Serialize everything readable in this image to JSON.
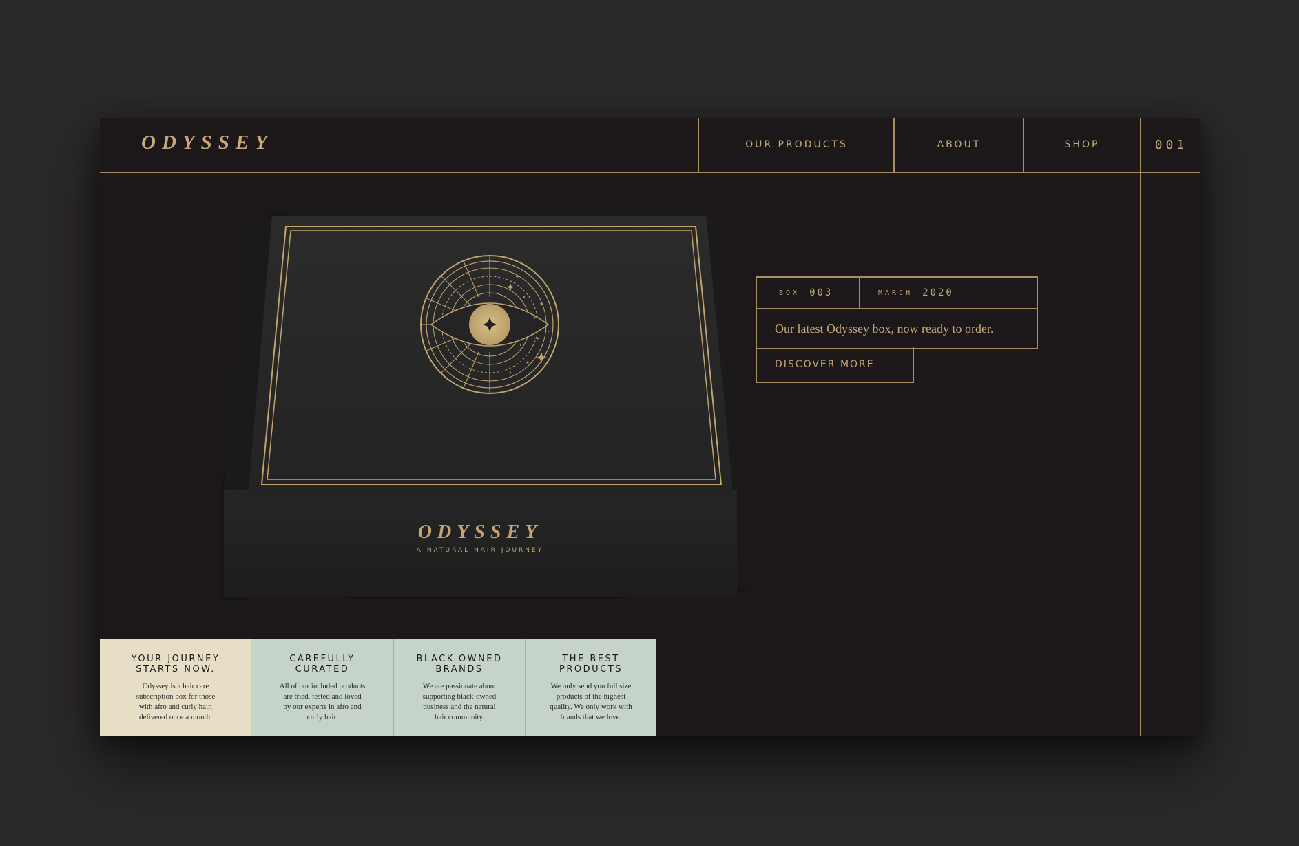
{
  "header": {
    "logo": "ODYSSEY",
    "nav": [
      "OUR PRODUCTS",
      "ABOUT",
      "SHOP"
    ],
    "page_number": "001"
  },
  "product_box": {
    "brand": "ODYSSEY",
    "tagline": "A NATURAL HAIR JOURNEY"
  },
  "info": {
    "box_label": "BOX",
    "box_number": "003",
    "month": "MARCH",
    "year": "2020",
    "description": "Our latest Odyssey box, now ready to order.",
    "cta": "DISCOVER MORE"
  },
  "features": [
    {
      "title_1": "YOUR JOURNEY",
      "title_2": "STARTS NOW.",
      "lines": [
        "Odyssey is a hair care",
        "subscription box for those",
        "with afro and curly hair,",
        "delivered once a month."
      ]
    },
    {
      "title_1": "CAREFULLY",
      "title_2": "CURATED",
      "lines": [
        "All of our included products",
        "are tried, tested and loved",
        "by our experts in afro and",
        "curly hair."
      ]
    },
    {
      "title_1": "BLACK-OWNED",
      "title_2": "BRANDS",
      "lines": [
        "We are passionate about",
        "supporting black-owned",
        "business and the natural",
        "hair community."
      ]
    },
    {
      "title_1": "THE BEST",
      "title_2": "PRODUCTS",
      "lines": [
        "We only send you full size",
        "products of the highest",
        "quality. We only work with",
        "brands that we love."
      ]
    }
  ],
  "colors": {
    "background": "#2b2829",
    "panel": "#1c1819",
    "gold": "#c8a97a",
    "cream": "#e6dfc6",
    "sage": "#c6d3c8"
  }
}
